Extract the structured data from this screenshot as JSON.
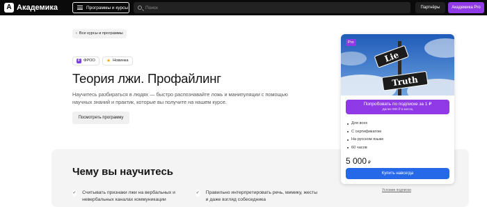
{
  "header": {
    "logo_mark": "А",
    "logo_text": "Академика",
    "menu_label": "Программы и курсы",
    "search_placeholder": "Поиск",
    "partners_label": "Партнёры",
    "pro_label": "Академика Pro"
  },
  "breadcrumb": {
    "back_icon": "‹",
    "back_label": "Все курсы и программы"
  },
  "badges": [
    {
      "icon": "F",
      "label": "ФРОО"
    },
    {
      "icon": "★",
      "label": "Новинка"
    }
  ],
  "course": {
    "title": "Теория лжи. Профайлинг",
    "description": "Научитесь разбираться в людях — быстро распознавайте ложь и манипуляции с помощью научных знаний и практик, которые вы получите на нашем курсе.",
    "program_button": "Посмотреть программу"
  },
  "learn": {
    "title": "Чему вы научитесь",
    "items": [
      "Считывать признаки лжи на вербальных и невербальных каналах коммуникации",
      "Правильно интерпретировать речь, мимику, жесты и даже взгляд собеседника"
    ],
    "check_icon": "✓"
  },
  "card": {
    "pro_tag": "Pro",
    "sign_top": "Lie",
    "sign_bottom": "Truth",
    "subscribe_label": "Попробовать по подписке за 1 ₽",
    "subscribe_sub": "Далее 990 ₽ в месяц",
    "features": [
      "Для всех",
      "С сертификатом",
      "На русском языке",
      "60 часов"
    ],
    "price": "5 000",
    "currency": "₽",
    "buy_label": "Купить навсегда",
    "terms_label": "Условия подписки"
  },
  "colors": {
    "accent": "#8f3ae6",
    "primary": "#2568e8",
    "topbar": "#0a0a0a"
  }
}
